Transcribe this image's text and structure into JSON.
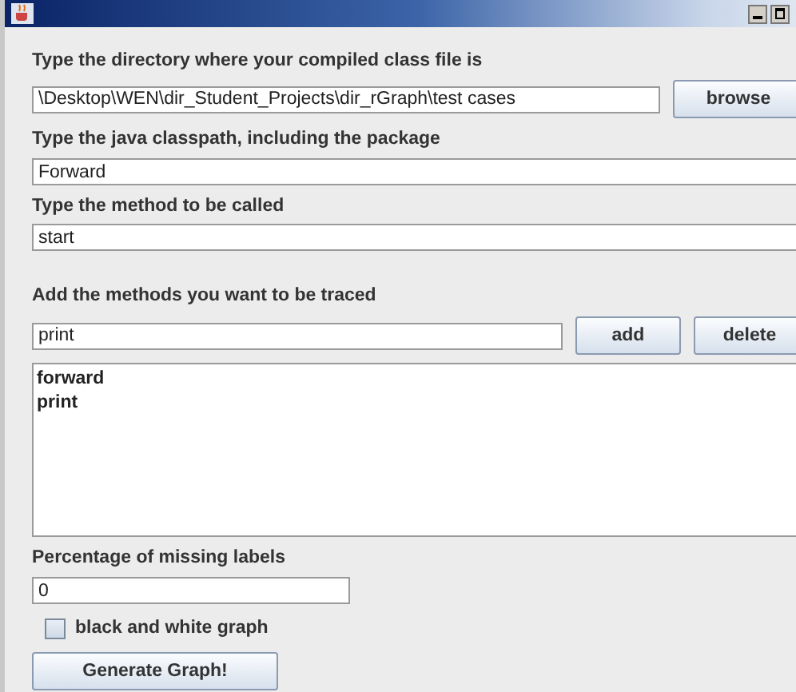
{
  "directory": {
    "label": "Type the directory where your compiled class file is",
    "value": "\\Desktop\\WEN\\dir_Student_Projects\\dir_rGraph\\test cases",
    "button": "browse"
  },
  "classpath": {
    "label": "Type the java classpath, including the package",
    "value": "Forward"
  },
  "method": {
    "label": "Type the method to be called",
    "value": "start"
  },
  "traced": {
    "label": "Add the methods you want to be traced",
    "value": "print",
    "buttons": [
      "add",
      "delete"
    ],
    "items": [
      "forward",
      "print"
    ]
  },
  "missing": {
    "label": "Percentage of missing labels",
    "value": "0"
  },
  "black_and_white": {
    "label": "black and white graph",
    "checked": false
  },
  "generate_button": "Generate Graph!"
}
